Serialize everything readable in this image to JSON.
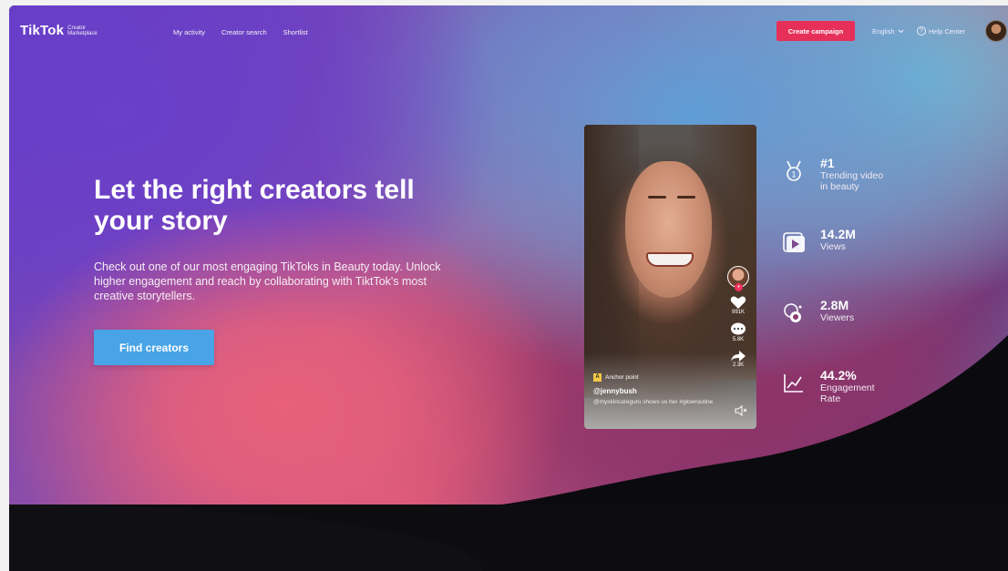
{
  "nav": {
    "logo": "TikTok",
    "logo_sub": "Creator Marketplace",
    "links": [
      "My activity",
      "Creator search",
      "Shortlist"
    ],
    "create_campaign": "Create campaign",
    "language": "English",
    "help": "Help Center"
  },
  "hero": {
    "headline": "Let the right creators tell your story",
    "subtext": "Check out one of our most engaging TikToks in Beauty today. Unlock higher engagement and reach by collaborating with TiktTok's most creative storytellers.",
    "cta": "Find creators"
  },
  "video": {
    "likes": "991K",
    "comments": "5.8K",
    "shares": "2.3K",
    "anchor": "Anchor point",
    "handle": "@jennybush",
    "caption": "@myskincareguru shows us her #glowroutine"
  },
  "stats": [
    {
      "icon": "medal-icon",
      "value": "#1",
      "label": "Trending video in beauty"
    },
    {
      "icon": "play-icon",
      "value": "14.2M",
      "label": "Views"
    },
    {
      "icon": "viewers-icon",
      "value": "2.8M",
      "label": "Viewers"
    },
    {
      "icon": "chart-icon",
      "value": "44.2%",
      "label": "Engagement Rate"
    }
  ],
  "colors": {
    "accent": "#e6305a",
    "cta": "#48a4e6"
  }
}
